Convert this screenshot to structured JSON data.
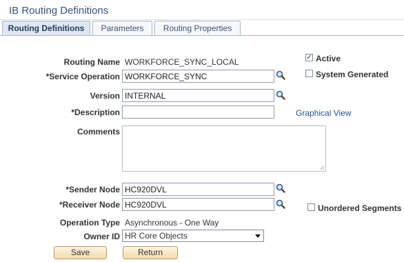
{
  "page": {
    "title": "IB Routing Definitions"
  },
  "tabs": [
    {
      "label": "Routing Definitions",
      "active": true
    },
    {
      "label": "Parameters",
      "active": false
    },
    {
      "label": "Routing Properties",
      "active": false
    }
  ],
  "form": {
    "routing_name": {
      "label": "Routing Name",
      "value": "WORKFORCE_SYNC_LOCAL"
    },
    "service_operation": {
      "label": "*Service Operation",
      "value": "WORKFORCE_SYNC"
    },
    "version": {
      "label": "Version",
      "value": "INTERNAL"
    },
    "description": {
      "label": "*Description",
      "value": ""
    },
    "comments": {
      "label": "Comments",
      "value": ""
    },
    "sender_node": {
      "label": "*Sender Node",
      "value": "HC920DVL"
    },
    "receiver_node": {
      "label": "*Receiver Node",
      "value": "HC920DVL"
    },
    "operation_type": {
      "label": "Operation Type",
      "value": "Asynchronous - One Way"
    },
    "owner_id": {
      "label": "Owner ID",
      "value": "HR Core Objects"
    }
  },
  "checkboxes": {
    "active": {
      "label": "Active",
      "checked": true
    },
    "system_generated": {
      "label": "System Generated",
      "checked": false
    },
    "unordered_segments": {
      "label": "Unordered Segments",
      "checked": false
    }
  },
  "links": {
    "graphical_view": "Graphical View"
  },
  "buttons": {
    "save": "Save",
    "return": "Return"
  },
  "icons": {
    "lookup": "magnifier-icon",
    "dropdown": "chevron-down-icon",
    "resize": "resize-grip-icon"
  },
  "colors": {
    "title": "#36527a",
    "link": "#1f4f91",
    "tab_active_bg": "#dfe7f2",
    "button_bg": "#f4dcae"
  }
}
